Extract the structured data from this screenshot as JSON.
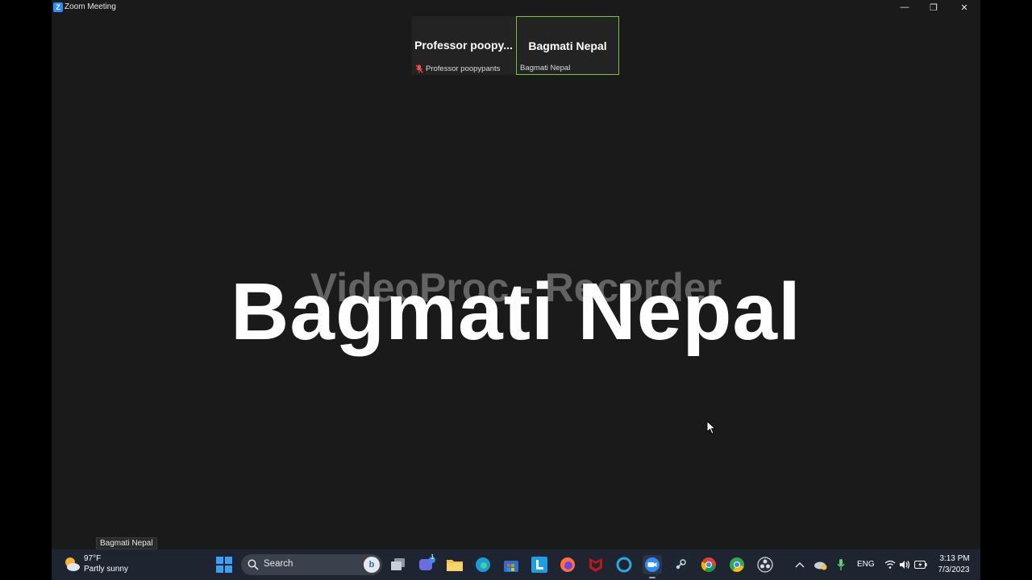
{
  "window": {
    "app_icon_letter": "Z",
    "title": "Zoom Meeting",
    "minimize_glyph": "—",
    "maximize_glyph": "❐",
    "close_glyph": "✕"
  },
  "participants": [
    {
      "display_name": "Professor  poopy...",
      "label": "Professor poopypants",
      "muted": true
    },
    {
      "display_name": "Bagmati Nepal",
      "label": "Bagmati Nepal",
      "muted": false,
      "active_speaker": true
    }
  ],
  "main_view": {
    "speaker_name": "Bagmati Nepal",
    "watermark": "VideoProc - Recorder"
  },
  "tooltip": "Bagmati Nepal",
  "taskbar": {
    "weather": {
      "temp": "97°F",
      "condition": "Partly sunny"
    },
    "search": {
      "placeholder": "Search",
      "bing_letter": "b"
    },
    "chat_badge": "1",
    "language": "ENG",
    "time": "3:13 PM",
    "date": "7/3/2023",
    "pinned_apps": [
      "start-icon",
      "search-box",
      "task-view-icon",
      "teams-chat-icon",
      "file-explorer-icon",
      "edge-icon",
      "microsoft-store-icon",
      "l-app-icon",
      "firefox-icon",
      "mcafee-icon",
      "cortana-icon",
      "zoom-icon",
      "steam-icon",
      "chrome-icon",
      "chrome-canary-icon",
      "davinci-resolve-icon"
    ]
  },
  "colors": {
    "active_speaker_border": "#7cc33a",
    "zoom_blue": "#2d8cff",
    "taskbar_bg": "#1f2530"
  }
}
